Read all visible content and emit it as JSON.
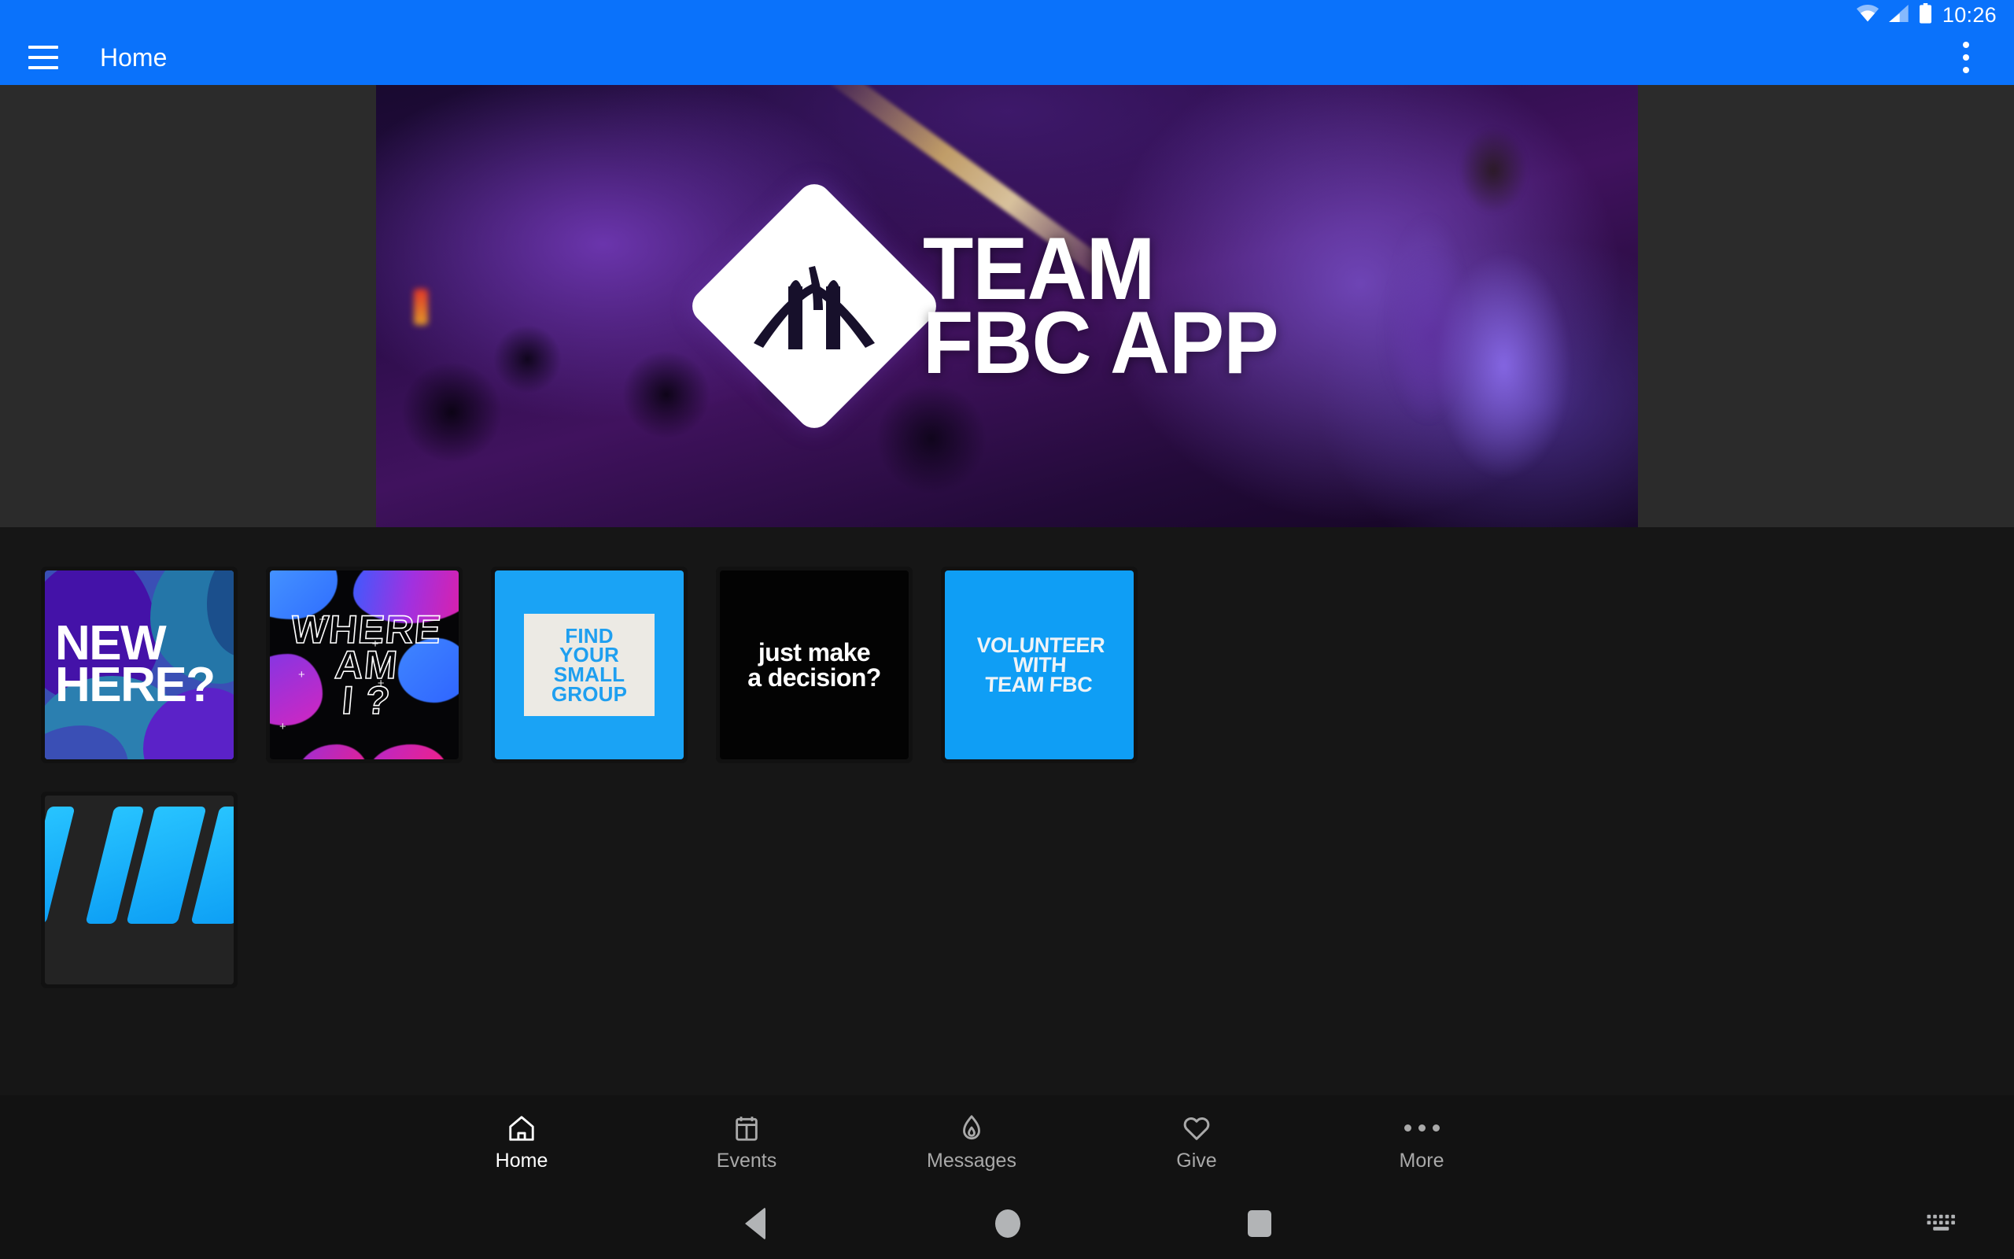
{
  "status_bar": {
    "time": "10:26",
    "icons": [
      "wifi-icon",
      "cellular-signal-icon",
      "battery-icon"
    ]
  },
  "app_bar": {
    "menu_icon": "hamburger-menu-icon",
    "title": "Home",
    "overflow_icon": "overflow-menu-icon",
    "background_color": "#0a72fb"
  },
  "hero": {
    "line1": "TEAM",
    "line2": "FBC APP",
    "logo": "bridge-diamond-logo"
  },
  "cards": [
    {
      "name": "new-here",
      "lines": [
        "NEW",
        "HERE?"
      ],
      "bg_color": "#3a4fb5"
    },
    {
      "name": "where-am-i",
      "lines": [
        "WHERE",
        "AM",
        "I ?"
      ],
      "bg_color": "#050507"
    },
    {
      "name": "find-your-small-group",
      "lines": [
        "FIND",
        "YOUR",
        "SMALL",
        "GROUP"
      ],
      "bg_color": "#1aa3f5",
      "text_color": "#1e9ff0",
      "panel_color": "#eceae4"
    },
    {
      "name": "just-make-a-decision",
      "lines": [
        "just make",
        "a decision?"
      ],
      "bg_color": "#030303"
    },
    {
      "name": "volunteer-with-team-fbc",
      "lines": [
        "VOLUNTEER",
        "WITH",
        "TEAM FBC"
      ],
      "bg_color": "#0f9ef5"
    },
    {
      "name": "blue-bars-card",
      "lines": [],
      "bg_color": "#232323"
    }
  ],
  "bottom_nav": {
    "items": [
      {
        "label": "Home",
        "icon": "home-icon",
        "active": true
      },
      {
        "label": "Events",
        "icon": "calendar-icon",
        "active": false
      },
      {
        "label": "Messages",
        "icon": "flame-icon",
        "active": false
      },
      {
        "label": "Give",
        "icon": "heart-icon",
        "active": false
      },
      {
        "label": "More",
        "icon": "ellipsis-icon",
        "active": false
      }
    ],
    "active_color": "#ffffff",
    "inactive_color": "#a9a9a9"
  },
  "system_nav": {
    "back": "back-triangle-icon",
    "home": "home-circle-icon",
    "recents": "recents-square-icon",
    "keyboard": "keyboard-icon"
  }
}
